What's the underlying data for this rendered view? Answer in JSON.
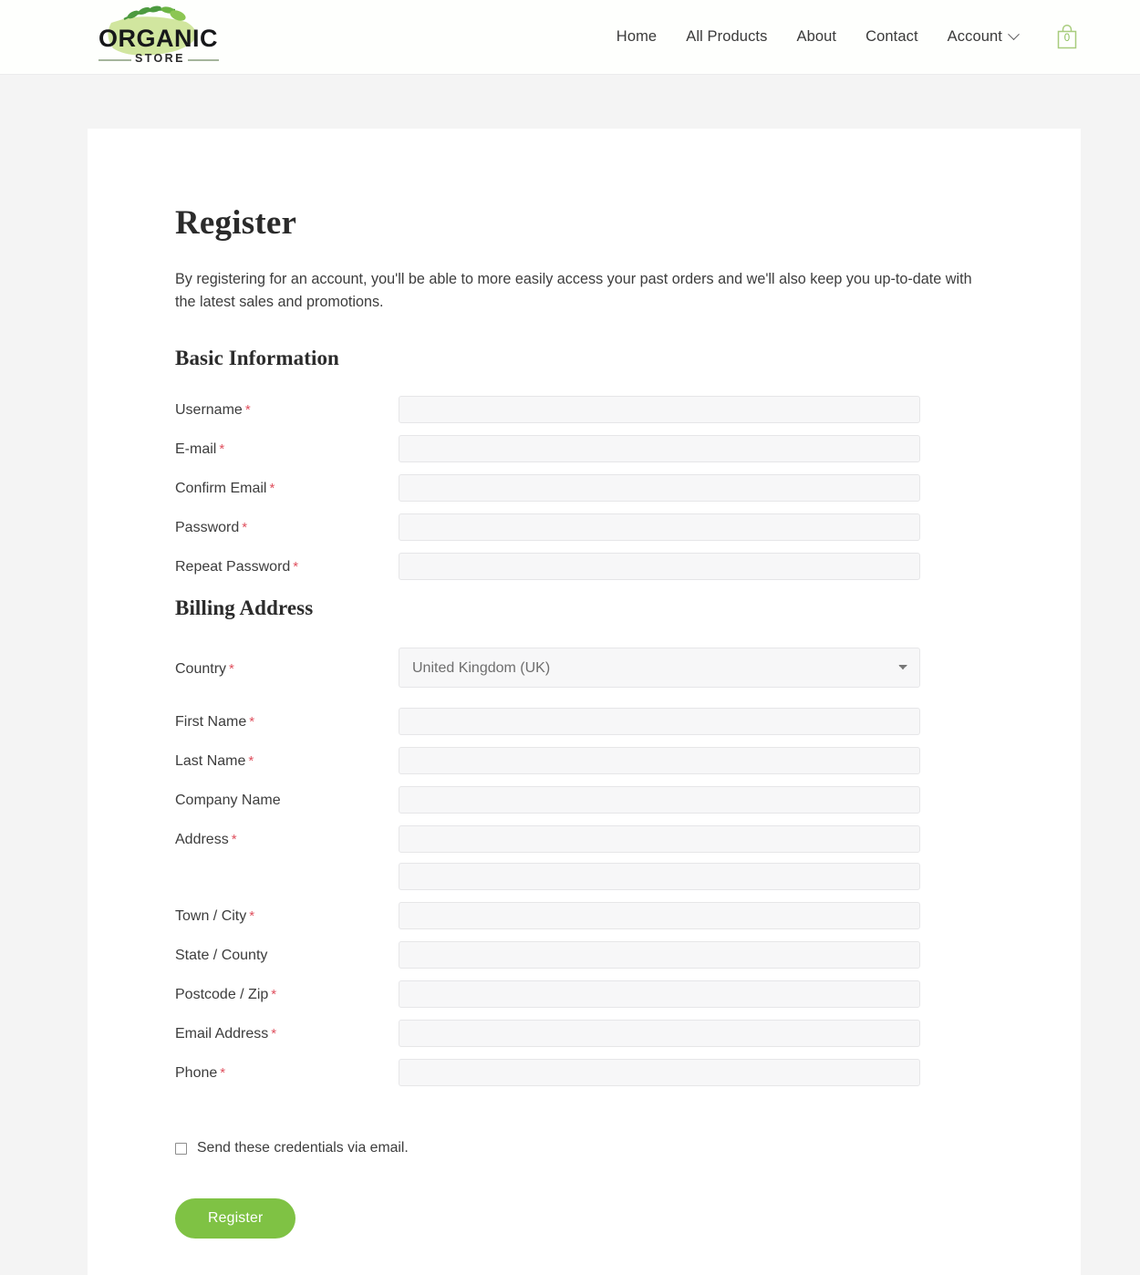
{
  "header": {
    "logo": {
      "primary_text": "ORGANIC",
      "secondary_text": "STORE",
      "leaf_color": "#4c9a3f",
      "blob_color": "#cfe59a",
      "text_color": "#1b1b1b"
    },
    "nav": [
      {
        "label": "Home",
        "has_dropdown": false
      },
      {
        "label": "All Products",
        "has_dropdown": false
      },
      {
        "label": "About",
        "has_dropdown": false
      },
      {
        "label": "Contact",
        "has_dropdown": false
      },
      {
        "label": "Account",
        "has_dropdown": true
      }
    ],
    "cart": {
      "count": "0",
      "icon": "shopping-bag-icon",
      "color": "#8bbf5a"
    }
  },
  "main": {
    "page_title": "Register",
    "intro": "By registering for an account, you'll be able to more easily access your past orders and we'll also keep you up-to-date with the latest sales and promotions.",
    "sections": [
      {
        "title": "Basic Information",
        "fields": [
          {
            "label": "Username",
            "required": true,
            "type": "text",
            "value": "",
            "placeholder": ""
          },
          {
            "label": "E-mail",
            "required": true,
            "type": "text",
            "value": "",
            "placeholder": ""
          },
          {
            "label": "Confirm Email",
            "required": true,
            "type": "text",
            "value": "",
            "placeholder": ""
          },
          {
            "label": "Password",
            "required": true,
            "type": "password",
            "value": "",
            "placeholder": ""
          },
          {
            "label": "Repeat Password",
            "required": true,
            "type": "password",
            "value": "",
            "placeholder": ""
          }
        ]
      },
      {
        "title": "Billing Address",
        "fields": [
          {
            "label": "Country",
            "required": true,
            "type": "select",
            "value": "United Kingdom (UK)",
            "placeholder": ""
          },
          {
            "label": "First Name",
            "required": true,
            "type": "text",
            "value": "",
            "placeholder": ""
          },
          {
            "label": "Last Name",
            "required": true,
            "type": "text",
            "value": "",
            "placeholder": ""
          },
          {
            "label": "Company Name",
            "required": false,
            "type": "text",
            "value": "",
            "placeholder": ""
          },
          {
            "label": "Address",
            "required": true,
            "type": "text",
            "value": "",
            "placeholder": ""
          },
          {
            "label": "",
            "required": false,
            "type": "text",
            "value": "",
            "placeholder": ""
          },
          {
            "label": "Town / City",
            "required": true,
            "type": "text",
            "value": "",
            "placeholder": ""
          },
          {
            "label": "State / County",
            "required": false,
            "type": "text",
            "value": "",
            "placeholder": ""
          },
          {
            "label": "Postcode / Zip",
            "required": true,
            "type": "text",
            "value": "",
            "placeholder": ""
          },
          {
            "label": "Email Address",
            "required": true,
            "type": "text",
            "value": "",
            "placeholder": ""
          },
          {
            "label": "Phone",
            "required": true,
            "type": "text",
            "value": "",
            "placeholder": ""
          }
        ]
      }
    ],
    "checkbox": {
      "label": "Send these credentials via email.",
      "checked": false
    },
    "submit_label": "Register"
  },
  "colors": {
    "accent_green": "#7fc244",
    "required_red": "#df4f5d",
    "page_background": "#f4f4f4",
    "card_background": "#ffffff",
    "input_background": "#f7f7f8",
    "input_border": "#e6e6e8"
  }
}
